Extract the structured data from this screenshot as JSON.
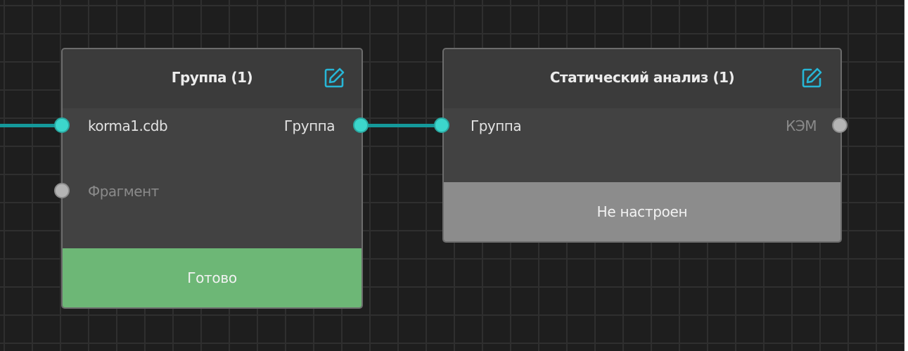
{
  "nodes": {
    "group": {
      "title": "Группа (1)",
      "edit_icon": "edit-icon",
      "input_ports": [
        {
          "label": "korma1.cdb",
          "state": "connected"
        },
        {
          "label": "Фрагмент",
          "state": "disconnected"
        }
      ],
      "output_ports": [
        {
          "label": "Группа",
          "state": "connected"
        }
      ],
      "status": "Готово",
      "status_color": "#6db776"
    },
    "static_analysis": {
      "title": "Статический анализ (1)",
      "edit_icon": "edit-icon",
      "input_ports": [
        {
          "label": "Группа",
          "state": "connected"
        }
      ],
      "output_ports": [
        {
          "label": "КЭМ",
          "state": "disconnected"
        }
      ],
      "status": "Не настроен",
      "status_color": "#8c8c8c"
    }
  },
  "colors": {
    "connection": "#14999a",
    "port_active": "#3cd6cc",
    "port_inactive": "#b4b4b4",
    "edit_icon": "#27b6d6",
    "canvas": "#1e1e1e",
    "grid": "#2f2f2f"
  }
}
